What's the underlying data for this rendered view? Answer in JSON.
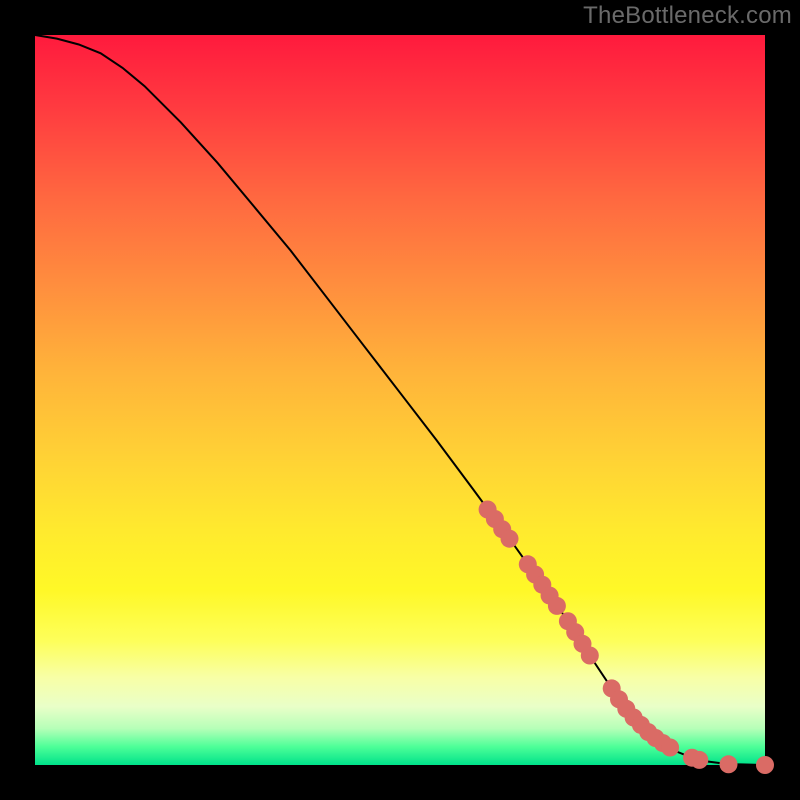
{
  "attribution": "TheBottleneck.com",
  "chart_data": {
    "type": "line",
    "title": "",
    "xlabel": "",
    "ylabel": "",
    "xlim": [
      0,
      100
    ],
    "ylim": [
      0,
      100
    ],
    "series": [
      {
        "name": "curve",
        "x": [
          0,
          3,
          6,
          9,
          12,
          15,
          20,
          25,
          30,
          35,
          40,
          45,
          50,
          55,
          60,
          65,
          70,
          73.5,
          76,
          78,
          80,
          82,
          84,
          86,
          88,
          90,
          92,
          94,
          96,
          98,
          100
        ],
        "y": [
          100,
          99.5,
          98.7,
          97.5,
          95.5,
          93.0,
          88.0,
          82.5,
          76.5,
          70.5,
          64.0,
          57.5,
          51.0,
          44.5,
          37.8,
          31.0,
          24.0,
          19.0,
          15.0,
          12.0,
          9.0,
          6.5,
          4.5,
          3.0,
          1.8,
          1.0,
          0.5,
          0.25,
          0.1,
          0.05,
          0.0
        ]
      }
    ],
    "markers": {
      "name": "highlighted-points",
      "x": [
        62,
        63,
        64,
        65,
        67.5,
        68.5,
        69.5,
        70.5,
        71.5,
        73,
        74,
        75,
        76,
        79,
        80,
        81,
        82,
        83,
        84,
        85,
        86,
        87,
        90,
        91,
        95,
        100
      ],
      "y": [
        35,
        33.7,
        32.3,
        31,
        27.5,
        26.1,
        24.7,
        23.2,
        21.8,
        19.7,
        18.2,
        16.6,
        15,
        10.5,
        9.0,
        7.7,
        6.5,
        5.5,
        4.5,
        3.7,
        3.0,
        2.4,
        1.0,
        0.7,
        0.1,
        0.0
      ]
    }
  }
}
